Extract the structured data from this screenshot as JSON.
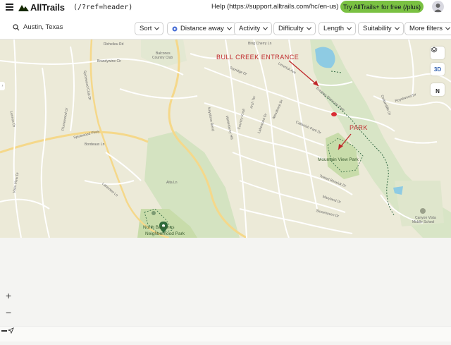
{
  "header": {
    "logo_text": "AllTrails",
    "header_link": "(/?ref=header)",
    "help_label": "Help",
    "help_url": "(https://support.alltrails.com/hc/en-us)",
    "cta_label": "Try AllTrails+ for free (/plus)"
  },
  "search": {
    "location": "Austin, Texas"
  },
  "filters": [
    {
      "label": "Sort"
    },
    {
      "label": "Distance away"
    },
    {
      "label": "Activity"
    },
    {
      "label": "Difficulty"
    },
    {
      "label": "Length"
    },
    {
      "label": "Suitability"
    },
    {
      "label": "More filters"
    }
  ],
  "map": {
    "controls": {
      "three_d_label": "3D",
      "north_label": "N"
    },
    "annotations": {
      "bull_creek": "BULL CREEK ENTRANCE",
      "park": "PARK"
    },
    "places": {
      "mountain_view_park": "Mountain View Park",
      "north_balcones_1": "North Balcones",
      "north_balcones_2": "Neighborhood Park",
      "balcones_cc_1": "Balcones",
      "balcones_cc_2": "Country Club",
      "canyon_vista_1": "Canyon Vista",
      "canyon_vista_2": "Middle School"
    },
    "streets": {
      "richelieu": "Richelieu Rd",
      "brandywine": "Brandywine Cir",
      "spicewood_club": "Spicewood Club Dr",
      "spicewood_pkwy": "Spicewood Pkwy",
      "bordeaux": "Bordeaux Ln",
      "plumewood": "Plumewood Dr",
      "keystone": "Keystone Bend",
      "winterberry": "Winterberry Hill",
      "country_knoll": "Country Knoll",
      "arch_ter": "Arch Ter",
      "lakewood": "Lakewood Dr",
      "mossback": "Mossback Dr",
      "callanish": "Callanish Park Dr",
      "tweed_berwick": "Tweed Berwick Dr",
      "maryland": "Maryland Dr",
      "stonehaven": "Stonehaven Dr",
      "royalwood": "Royalwood Dr",
      "cedarcliffe": "Cedarcliffe Dr",
      "big_cherry": "Bing Cherry Ln",
      "limerick": "Limerick Ave",
      "topridge": "Topridge Dr",
      "fountain_drive": "Fountain",
      "boulder": "Boulder Ln",
      "lakewood_2": "Lakewood Dr",
      "vista_view": "Vista View Dr",
      "mesa": "Mesa Dr",
      "lennox": "Lennox Dr",
      "laureate": "Lakeview Ln",
      "ashes": "Ashes Dr",
      "albata": "Alta Ln",
      "ralston": "Thunder Ln",
      "evening_primrose": "Evening Primrose Path"
    }
  }
}
